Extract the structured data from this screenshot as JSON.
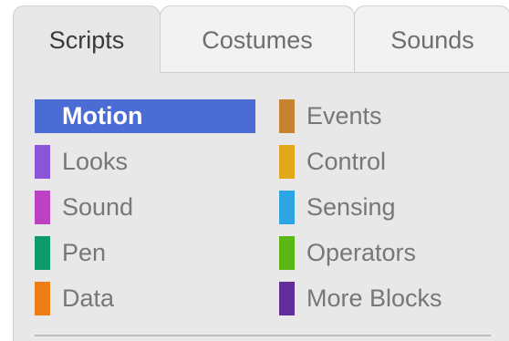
{
  "tabs": [
    {
      "label": "Scripts",
      "active": true
    },
    {
      "label": "Costumes",
      "active": false
    },
    {
      "label": "Sounds",
      "active": false
    }
  ],
  "categories": {
    "selected": "Motion",
    "left": [
      {
        "label": "Motion",
        "color": "#4a6cd4"
      },
      {
        "label": "Looks",
        "color": "#8a55d7"
      },
      {
        "label": "Sound",
        "color": "#bb42c3"
      },
      {
        "label": "Pen",
        "color": "#0e9a6c"
      },
      {
        "label": "Data",
        "color": "#ee7d16"
      }
    ],
    "right": [
      {
        "label": "Events",
        "color": "#c88330"
      },
      {
        "label": "Control",
        "color": "#e1a91a"
      },
      {
        "label": "Sensing",
        "color": "#2ca5e2"
      },
      {
        "label": "Operators",
        "color": "#5cb712"
      },
      {
        "label": "More Blocks",
        "color": "#632d99"
      }
    ]
  }
}
